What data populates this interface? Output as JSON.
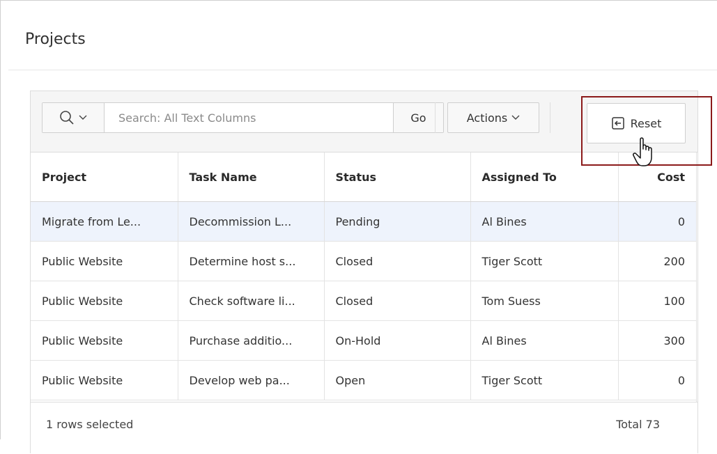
{
  "page": {
    "title": "Projects"
  },
  "toolbar": {
    "search_placeholder": "Search: All Text Columns",
    "go_label": "Go",
    "actions_label": "Actions",
    "reset_label": "Reset"
  },
  "grid": {
    "columns": [
      "Project",
      "Task Name",
      "Status",
      "Assigned To",
      "Cost"
    ],
    "rows": [
      {
        "project": "Migrate from Le...",
        "task": "Decommission L...",
        "status": "Pending",
        "assigned": "Al Bines",
        "cost": "0",
        "selected": true
      },
      {
        "project": "Public Website",
        "task": "Determine host s...",
        "status": "Closed",
        "assigned": "Tiger Scott",
        "cost": "200",
        "selected": false
      },
      {
        "project": "Public Website",
        "task": "Check software li...",
        "status": "Closed",
        "assigned": "Tom Suess",
        "cost": "100",
        "selected": false
      },
      {
        "project": "Public Website",
        "task": "Purchase additio...",
        "status": "On-Hold",
        "assigned": "Al Bines",
        "cost": "300",
        "selected": false
      },
      {
        "project": "Public Website",
        "task": "Develop web pa...",
        "status": "Open",
        "assigned": "Tiger Scott",
        "cost": "0",
        "selected": false
      }
    ]
  },
  "footer": {
    "selection": "1 rows selected",
    "total": "Total 73"
  },
  "icons": {
    "search": "search-icon",
    "chevron": "chevron-down-icon",
    "reset": "reset-icon",
    "cursor": "hand-cursor-icon"
  },
  "colors": {
    "highlight": "#8b1a1a",
    "selected_row": "#eef3fc"
  }
}
